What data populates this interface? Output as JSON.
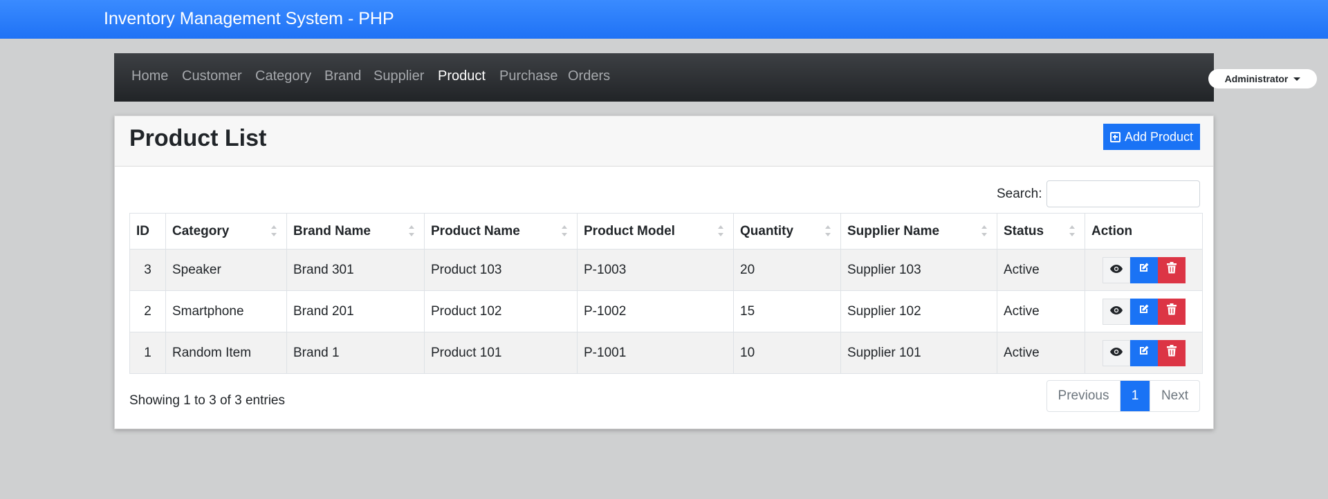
{
  "topbar": {
    "title": "Inventory Management System - PHP"
  },
  "nav": {
    "items": [
      {
        "label": "Home"
      },
      {
        "label": "Customer"
      },
      {
        "label": "Category"
      },
      {
        "label": "Brand"
      },
      {
        "label": "Supplier"
      },
      {
        "label": "Product",
        "active": true
      },
      {
        "label": "Purchase"
      },
      {
        "label": "Orders"
      }
    ],
    "user_menu": "Administrator"
  },
  "page": {
    "title": "Product List",
    "add_button": "Add Product",
    "search_label": "Search:",
    "search_value": ""
  },
  "table": {
    "columns": [
      "ID",
      "Category",
      "Brand Name",
      "Product Name",
      "Product Model",
      "Quantity",
      "Supplier Name",
      "Status",
      "Action"
    ],
    "rows": [
      {
        "id": "3",
        "category": "Speaker",
        "brand": "Brand 301",
        "product": "Product 103",
        "model": "P-1003",
        "quantity": "20",
        "supplier": "Supplier 103",
        "status": "Active"
      },
      {
        "id": "2",
        "category": "Smartphone",
        "brand": "Brand 201",
        "product": "Product 102",
        "model": "P-1002",
        "quantity": "15",
        "supplier": "Supplier 102",
        "status": "Active"
      },
      {
        "id": "1",
        "category": "Random Item",
        "brand": "Brand 1",
        "product": "Product 101",
        "model": "P-1001",
        "quantity": "10",
        "supplier": "Supplier 101",
        "status": "Active"
      }
    ],
    "action_icons": [
      "eye-icon",
      "edit-icon",
      "trash-icon"
    ]
  },
  "footer": {
    "info": "Showing 1 to 3 of 3 entries",
    "pagination": {
      "previous": "Previous",
      "current": "1",
      "next": "Next"
    }
  },
  "colors": {
    "topbar": "#1f72f5",
    "primary": "#1a73f5",
    "danger": "#dc3545",
    "navbar": "#2a2d31",
    "background": "#cfd0d1"
  }
}
